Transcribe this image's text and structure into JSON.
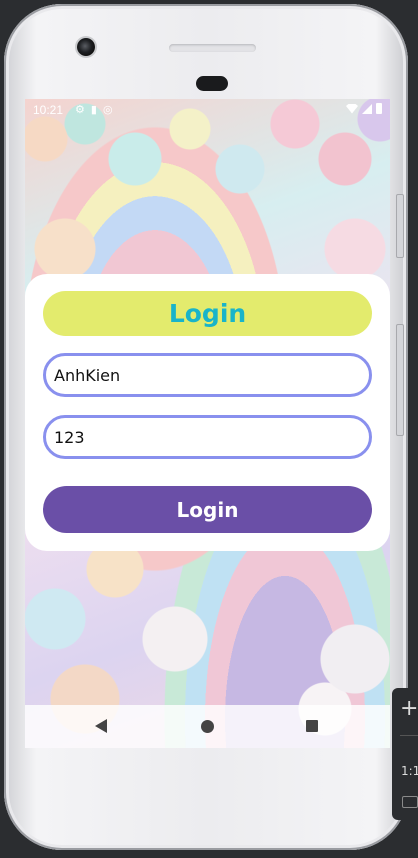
{
  "statusbar": {
    "time": "10:21",
    "left_icons": [
      "settings-icon",
      "sim-icon",
      "sync-icon"
    ],
    "right_icons": [
      "wifi-icon",
      "signal-icon",
      "battery-icon"
    ]
  },
  "login_card": {
    "title": "Login",
    "username_value": "AnhKien",
    "password_value": "123",
    "login_button_label": "Login"
  },
  "navbar": {
    "icons": [
      "back-icon",
      "home-icon",
      "recents-icon"
    ]
  },
  "emulator_toolbar": {
    "zoom_in_symbol": "+",
    "ratio_label": "1:1"
  },
  "colors": {
    "title_pill_bg": "#e3eb6d",
    "title_text": "#19b4c9",
    "field_border": "#8990ee",
    "login_button_bg": "#6a4fa7",
    "card_bg": "#ffffff"
  }
}
